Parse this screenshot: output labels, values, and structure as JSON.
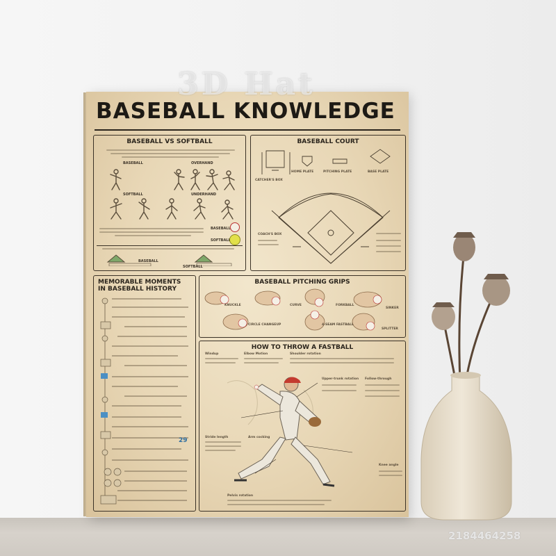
{
  "poster": {
    "title": "BASEBALL KNOWLEDGE",
    "sections": {
      "vs": {
        "heading": "BASEBALL VS SOFTBALL",
        "labels": [
          "BASEBALL",
          "OVERHAND",
          "SOFTBALL",
          "UNDERHAND",
          "BASEBALL",
          "SOFTBALL",
          "BASEBALL",
          "SOFTBALL"
        ]
      },
      "court": {
        "heading": "BASEBALL COURT",
        "labels": [
          "HOME PLATE",
          "PITCHING PLATE",
          "BASE PLATE",
          "CATCHER'S BOX",
          "COACH'S BOX"
        ]
      },
      "history": {
        "heading_line1": "MEMORABLE MOMENTS",
        "heading_line2": "IN BASEBALL HISTORY",
        "numbers": [
          "29"
        ]
      },
      "grips": {
        "heading": "BASEBALL PITCHING GRIPS",
        "labels": [
          "KNUCKLE",
          "CURVE",
          "FORKBALL",
          "SINKER",
          "CIRCLE CHANGEUP",
          "4-SEAM FASTBALL",
          "SPLITTER"
        ]
      },
      "fastball": {
        "heading": "HOW TO THROW A FASTBALL",
        "labels": [
          "Windup",
          "Elbow Motion",
          "Shoulder rotation",
          "Upper-trunk rotation",
          "Follow-through",
          "Stride length",
          "Arm cocking",
          "Knee angle",
          "Pelvis rotation"
        ]
      }
    }
  },
  "watermarks": [
    "3D Hat",
    "2184464258"
  ],
  "colors": {
    "paper": "#e8d7b6",
    "ink": "#2a241c",
    "vase": "#e6dcc9"
  }
}
